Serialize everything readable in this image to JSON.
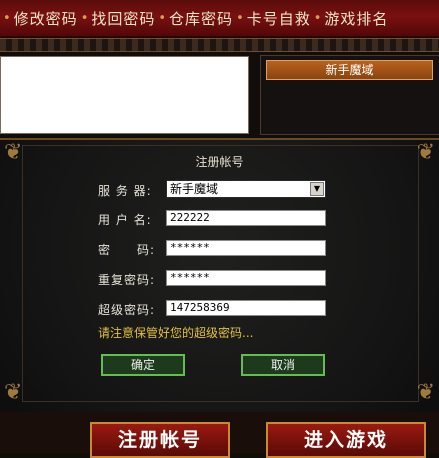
{
  "nav": {
    "items": [
      "修改密码",
      "找回密码",
      "仓库密码",
      "卡号自救",
      "游戏排名"
    ],
    "separator": "•"
  },
  "server_chip": "新手魔域",
  "form": {
    "title": "注册帐号",
    "server_label": "服 务 器:",
    "server_value": "新手魔域",
    "username_label": "用 户 名:",
    "username_value": "222222",
    "password_label": "密　　码:",
    "password_value": "******",
    "confirm_label": "重复密码:",
    "confirm_value": "******",
    "super_label": "超级密码:",
    "super_value": "147258369",
    "hint": "请注意保管好您的超级密码...",
    "ok": "确定",
    "cancel": "取消"
  },
  "bottom": {
    "register": "注册帐号",
    "enter": "进入游戏"
  }
}
